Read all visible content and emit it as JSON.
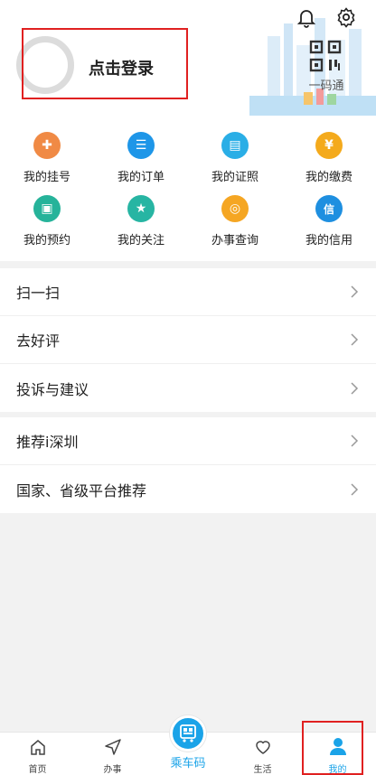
{
  "header": {
    "login_text": "点击登录",
    "qr_label": "一码通"
  },
  "services": [
    {
      "label": "我的挂号",
      "color": "#f08a45",
      "glyph": "✚"
    },
    {
      "label": "我的订单",
      "color": "#1e96e8",
      "glyph": "☰"
    },
    {
      "label": "我的证照",
      "color": "#2aaee6",
      "glyph": "▤"
    },
    {
      "label": "我的缴费",
      "color": "#f4aa1c",
      "glyph": "¥"
    },
    {
      "label": "我的预约",
      "color": "#26b39a",
      "glyph": "▣"
    },
    {
      "label": "我的关注",
      "color": "#27b5a3",
      "glyph": "★"
    },
    {
      "label": "办事查询",
      "color": "#f5a623",
      "glyph": "◎"
    },
    {
      "label": "我的信用",
      "color": "#1e8fe0",
      "glyph": "信"
    }
  ],
  "menu_group_1": [
    {
      "label": "扫一扫"
    },
    {
      "label": "去好评"
    },
    {
      "label": "投诉与建议"
    }
  ],
  "menu_group_2": [
    {
      "label": "推荐i深圳"
    },
    {
      "label": "国家、省级平台推荐"
    }
  ],
  "tabbar": {
    "home": "首页",
    "affairs": "办事",
    "ride_code": "乘车码",
    "life": "生活",
    "mine": "我的",
    "active_color": "#1aa3e8"
  }
}
